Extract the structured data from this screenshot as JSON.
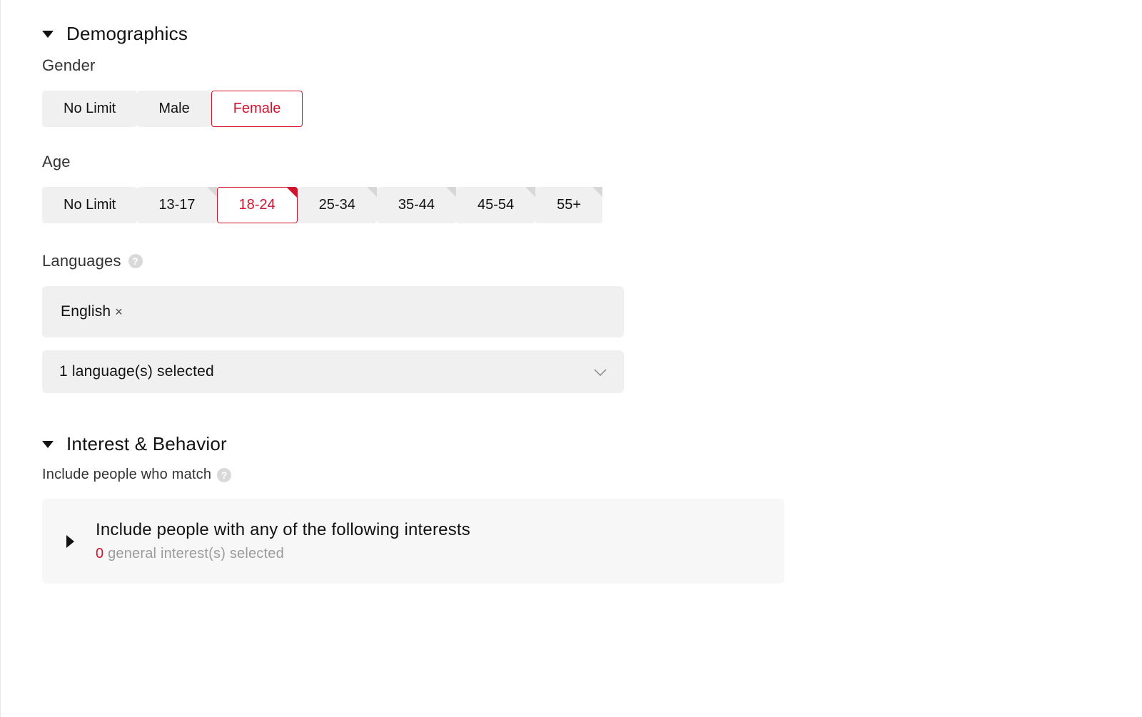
{
  "demographics": {
    "title": "Demographics",
    "gender": {
      "label": "Gender",
      "options": [
        "No Limit",
        "Male",
        "Female"
      ],
      "selected_index": 2
    },
    "age": {
      "label": "Age",
      "options": [
        "No Limit",
        "13-17",
        "18-24",
        "25-34",
        "35-44",
        "45-54",
        "55+"
      ],
      "selected_index": 2
    },
    "languages": {
      "label": "Languages",
      "tags": [
        "English"
      ],
      "summary": "1 language(s) selected"
    }
  },
  "interest": {
    "title": "Interest & Behavior",
    "sub_label": "Include people who match",
    "card": {
      "title": "Include people with any of the following interests",
      "count": "0",
      "count_suffix": " general interest(s) selected"
    }
  },
  "help_glyph": "?"
}
